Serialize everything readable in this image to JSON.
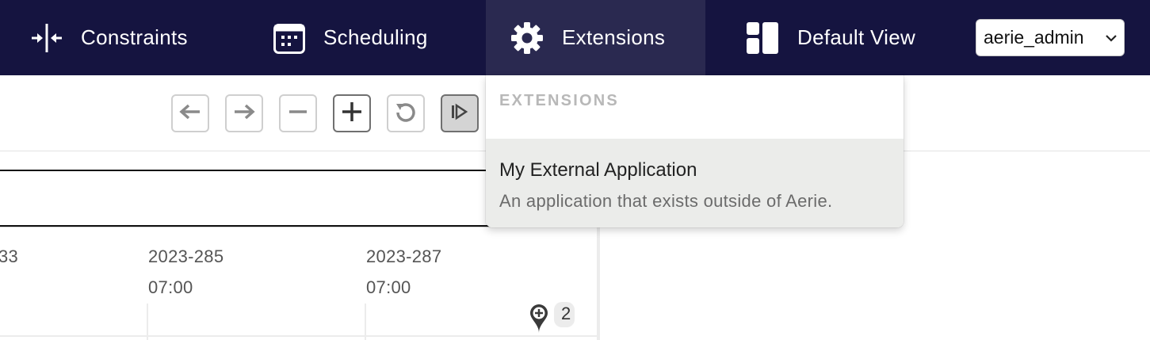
{
  "nav": {
    "constraints": {
      "label": "Constraints",
      "icon": "constraints-icon"
    },
    "scheduling": {
      "label": "Scheduling",
      "icon": "calendar-icon"
    },
    "extensions": {
      "label": "Extensions",
      "icon": "gear-icon"
    },
    "default_view": {
      "label": "Default View",
      "icon": "layout-icon"
    },
    "user": {
      "selected": "aerie_admin"
    }
  },
  "toolbar": {
    "buttons": [
      "arrow-left-icon",
      "arrow-right-icon",
      "zoom-out-icon",
      "zoom-in-icon",
      "reset-icon",
      "play-icon"
    ]
  },
  "timeline": {
    "ticks": [
      {
        "date": "33",
        "time": ""
      },
      {
        "date": "2023-285",
        "time": "07:00"
      },
      {
        "date": "2023-287",
        "time": "07:00"
      }
    ],
    "badge_count": "2"
  },
  "extensions_menu": {
    "heading": "EXTENSIONS",
    "items": [
      {
        "title": "My External Application",
        "description": "An application that exists outside of Aerie."
      }
    ]
  },
  "colors": {
    "topbar_bg": "#151440",
    "active_nav_bg": "#2a2950",
    "menu_item_hover": "#ebecea"
  }
}
